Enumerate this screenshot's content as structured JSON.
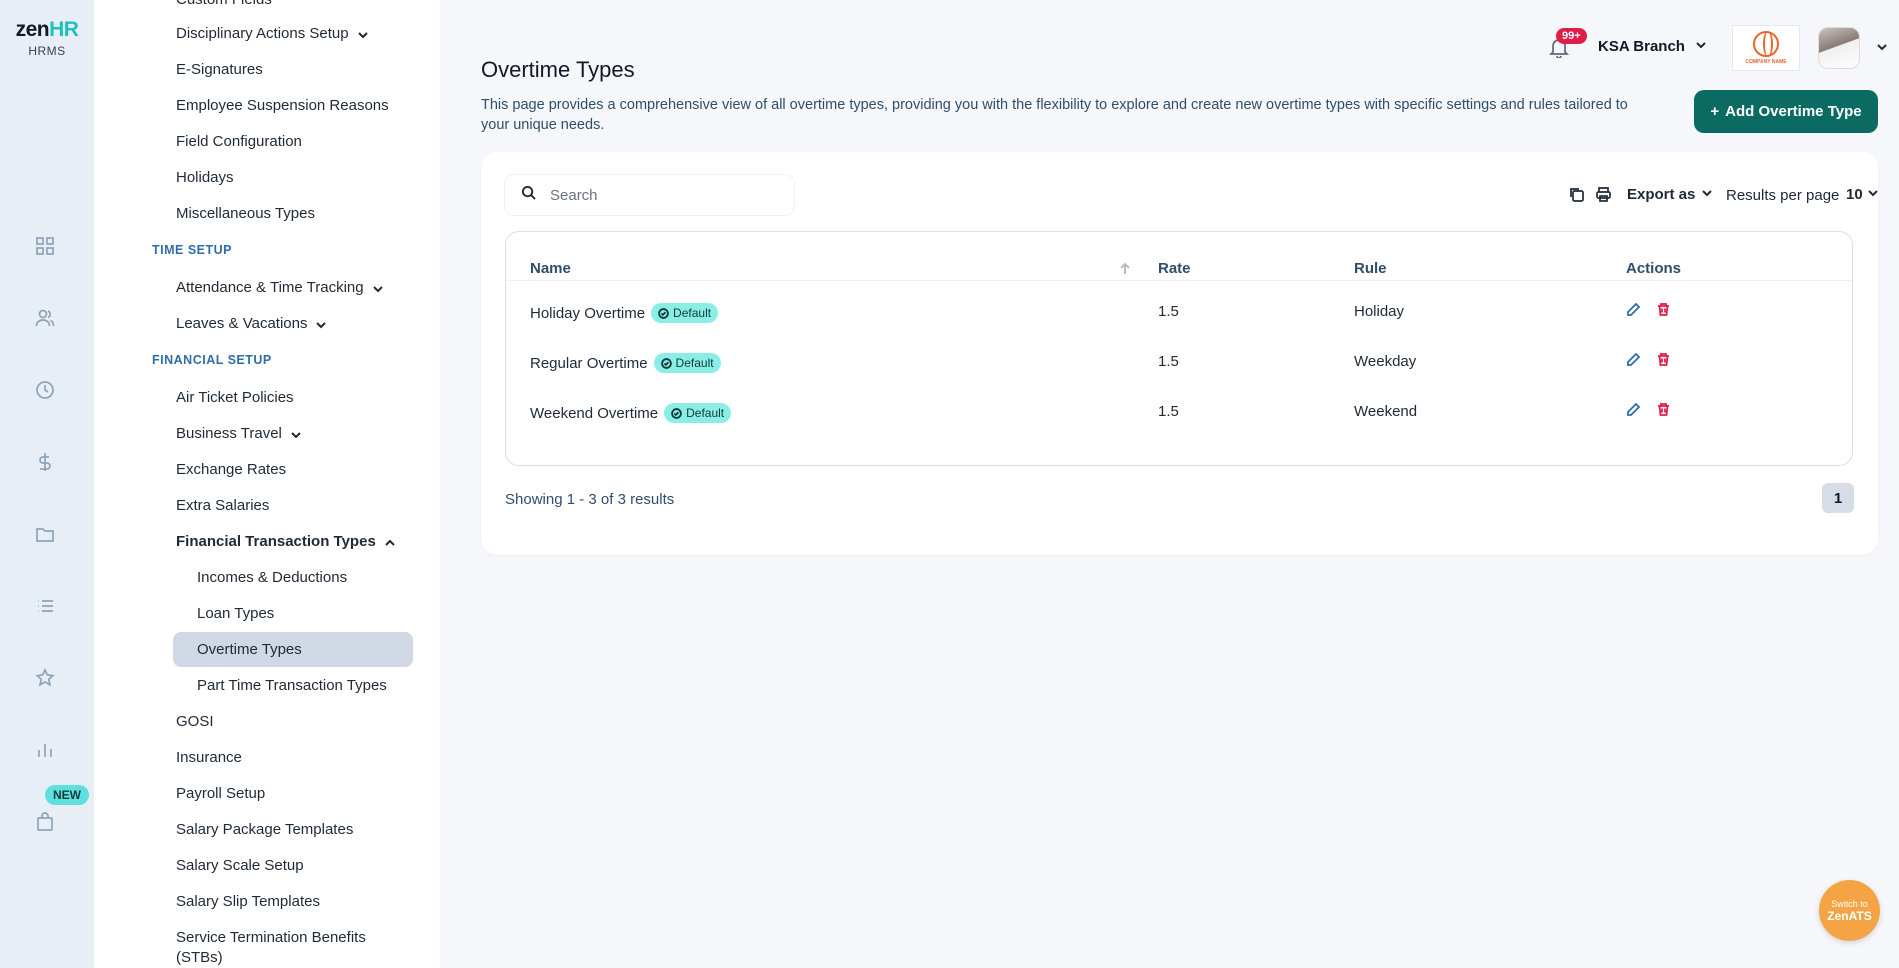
{
  "app": {
    "brand_main": "zen",
    "brand_accent": "HR",
    "subtitle": "HRMS",
    "new_badge": "NEW"
  },
  "colors": {
    "primary": "#0b6b63",
    "accent": "#1ec0c0",
    "badge_bg": "#8aeee6",
    "danger": "#e11d48",
    "section_label": "#2f6ea8"
  },
  "rail_icons": [
    "dashboard-icon",
    "people-icon",
    "clock-icon",
    "dollar-icon",
    "folder-icon",
    "list-icon",
    "star-icon",
    "chart-icon",
    "bag-icon"
  ],
  "sidebar": {
    "cut_item": "Custom Fields",
    "general_items": [
      {
        "label": "Disciplinary Actions Setup",
        "expandable": true
      },
      {
        "label": "E-Signatures"
      },
      {
        "label": "Employee Suspension Reasons"
      },
      {
        "label": "Field Configuration"
      },
      {
        "label": "Holidays"
      },
      {
        "label": "Miscellaneous Types"
      }
    ],
    "time_setup": {
      "title": "TIME SETUP",
      "items": [
        {
          "label": "Attendance & Time Tracking",
          "expandable": true
        },
        {
          "label": "Leaves & Vacations",
          "expandable": true
        }
      ]
    },
    "financial_setup": {
      "title": "FINANCIAL SETUP",
      "items": [
        {
          "label": "Air Ticket Policies"
        },
        {
          "label": "Business Travel",
          "expandable": true
        },
        {
          "label": "Exchange Rates"
        },
        {
          "label": "Extra Salaries"
        },
        {
          "label": "Financial Transaction Types",
          "expanded": true
        },
        {
          "label": "Incomes & Deductions"
        },
        {
          "label": "Loan Types"
        },
        {
          "label": "Overtime Types",
          "active": true
        },
        {
          "label": "Part Time Transaction Types"
        },
        {
          "label": "GOSI"
        },
        {
          "label": "Insurance"
        },
        {
          "label": "Payroll Setup"
        },
        {
          "label": "Salary Package Templates"
        },
        {
          "label": "Salary Scale Setup"
        },
        {
          "label": "Salary Slip Templates"
        },
        {
          "label": "Service Termination Benefits",
          "label2": "(STBs)"
        }
      ]
    }
  },
  "header": {
    "notification_count": "99+",
    "branch": "KSA Branch",
    "company_logo_text": "COMPANY NAME"
  },
  "page": {
    "title": "Overtime Types",
    "description": "This page provides a comprehensive view of all overtime types, providing you with the flexibility to explore and create new overtime types with specific settings and rules tailored to your unique needs.",
    "add_button": "Add Overtime Type"
  },
  "toolbar": {
    "search_placeholder": "Search",
    "export_label": "Export as",
    "results_per_page_label": "Results per page",
    "results_per_page_value": "10"
  },
  "table": {
    "columns": [
      "Name",
      "Rate",
      "Rule",
      "Actions"
    ],
    "rows": [
      {
        "name": "Holiday Overtime",
        "badge": "Default",
        "rate": "1.5",
        "rule": "Holiday"
      },
      {
        "name": "Regular Overtime",
        "badge": "Default",
        "rate": "1.5",
        "rule": "Weekday"
      },
      {
        "name": "Weekend Overtime",
        "badge": "Default",
        "rate": "1.5",
        "rule": "Weekend"
      }
    ]
  },
  "pagination": {
    "showing": "Showing 1 - 3 of 3 results",
    "current_page": "1"
  },
  "zenats": {
    "line1": "Switch to",
    "line2": "ZenATS"
  }
}
